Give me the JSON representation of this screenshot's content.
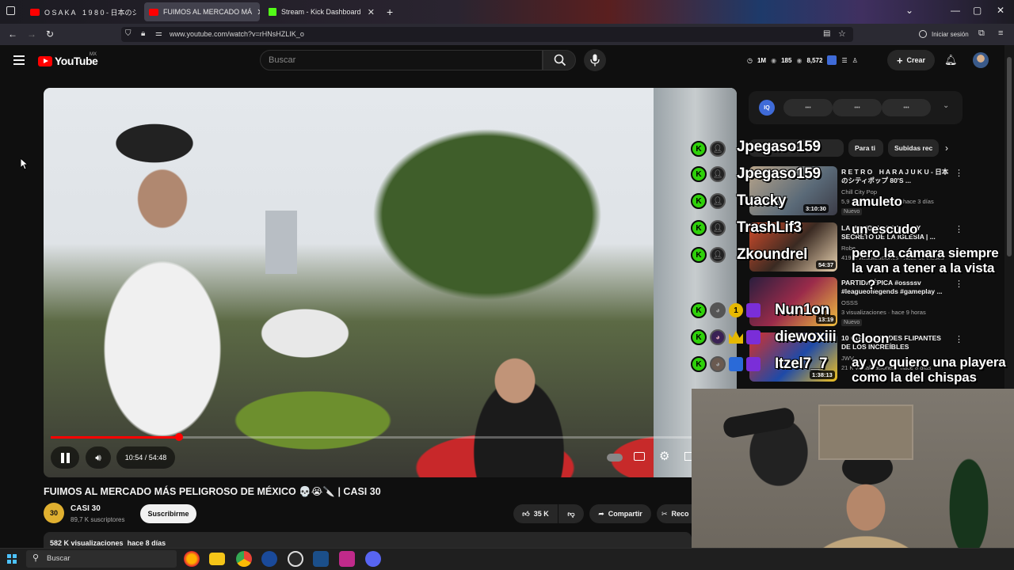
{
  "browser": {
    "tabs": [
      {
        "label": "O S A K A　1 9 8 0 - 日本のシティ",
        "active": false
      },
      {
        "label": "FUIMOS AL MERCADO MÁ",
        "active": true
      },
      {
        "label": "Stream - Kick Dashboard",
        "active": false
      }
    ],
    "url": "www.youtube.com/watch?v=rHNsHZLIK_o",
    "signin_label": "Iniciar sesión"
  },
  "youtube": {
    "logo_text": "YouTube",
    "country_code": "MX",
    "search_placeholder": "Buscar",
    "stats": {
      "a": "1M",
      "b": "185",
      "c": "8,572"
    },
    "create_label": "Crear"
  },
  "video": {
    "time": "10:54 / 54:48",
    "progress_fraction": 0.199,
    "title": "FUIMOS AL MERCADO MÁS PELIGROSO DE MÉXICO 💀😭🔪 | CASI 30",
    "channel": {
      "avatar_text": "30",
      "name": "CASI 30",
      "subscribers": "89,7 K suscriptores"
    },
    "subscribe_label": "Suscribirme",
    "likes": "35 K",
    "share_label": "Compartir",
    "clip_label": "Reco",
    "views": "582 K visualizaciones",
    "age": "hace 8 días"
  },
  "sidebar": {
    "iq_logo": "IQ",
    "iq_pills": [
      "•••",
      "•••",
      "•••"
    ],
    "chips": [
      "Relacionados",
      "Para ti",
      "Subidas rec"
    ],
    "recommendations": [
      {
        "title": "R E T R O　H A R A J U K U - 日本のシティポップ 80'S ...",
        "channel": "Chill City Pop",
        "meta": "5,9 M visualizaciones · hace 3 días",
        "duration": "3:10:30",
        "badge": "Nuevo"
      },
      {
        "title": "LA HISTORIA OSCURA Y SECRETO DE LA IGLESIA | ...",
        "channel": "Robe",
        "meta": "419 K visualizaciones · hace 10 meses",
        "duration": "54:37",
        "badge": ""
      },
      {
        "title": "PARTIDA ÉPICA #ossssv #leagueoflegends #gameplay ...",
        "channel": "OSSS",
        "meta": "3 visualizaciones · hace 9 horas",
        "duration": "13:19",
        "badge": "Nuevo"
      },
      {
        "title": "10 CURIOSIDADES FLIPANTES DE LOS INCREÍBLES",
        "channel": "JWV",
        "meta": "21 K visualizaciones · hace 8 días",
        "duration": "1:38:13",
        "badge": ""
      }
    ]
  },
  "chat": {
    "messages": [
      {
        "user": "Jpegaso159",
        "text": ""
      },
      {
        "user": "Jpegaso159",
        "text": ""
      },
      {
        "user": "Tuacky",
        "text": "amuleto"
      },
      {
        "user": "TrashLif3",
        "text": "un escudo"
      },
      {
        "user": "Zkoundrel",
        "text": "pero la cámara siempre la van a tener a la vista"
      },
      {
        "user": "Nun1on",
        "text": "?"
      },
      {
        "user": "diewoxiii",
        "text": "Cloon"
      },
      {
        "user": "Itzel7_7",
        "text": "ay yo quiero una playera como la del chispas"
      }
    ],
    "gold_badge": "1"
  },
  "taskbar": {
    "search_placeholder": "Buscar"
  },
  "colors": {
    "accent": "#ff0000",
    "kick_green": "#53fc18",
    "bg": "#0f0f0f"
  }
}
